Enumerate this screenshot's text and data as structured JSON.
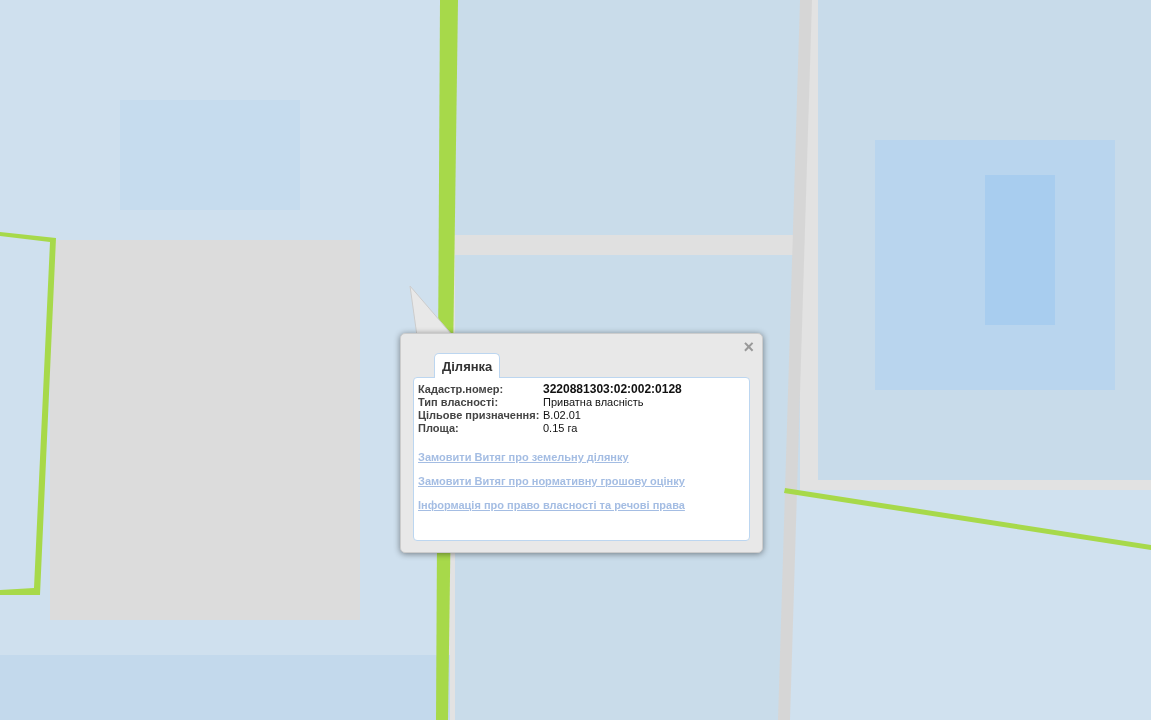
{
  "popup": {
    "close": "×",
    "tabs": [
      {
        "label": "Ділянка",
        "selected": true
      }
    ],
    "fields": [
      {
        "label": "Кадастр.номер:",
        "value": "3220881303:02:002:0128",
        "bold": true
      },
      {
        "label": "Тип власності:",
        "value": "Приватна власність",
        "bold": false
      },
      {
        "label": "Цільове призначення:",
        "value": "В.02.01",
        "bold": false
      },
      {
        "label": "Площа:",
        "value": "0.15 га",
        "bold": false
      }
    ],
    "links": [
      "Замовити Витяг про земельну ділянку",
      "Замовити Витяг про нормативну грошову оцінку",
      "Інформація про право власності та речові права"
    ]
  }
}
